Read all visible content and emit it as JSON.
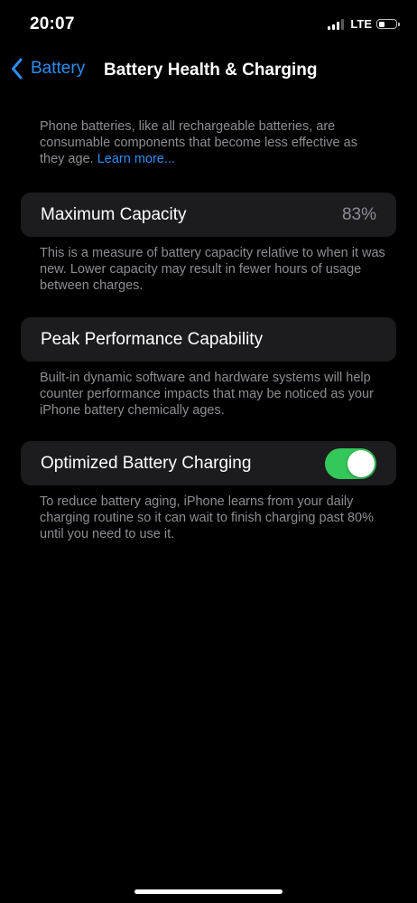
{
  "status_bar": {
    "time": "20:07",
    "network": "LTE",
    "signal_bars_active": 3,
    "signal_bars_total": 4,
    "battery_level": 0.4
  },
  "nav": {
    "back_label": "Battery",
    "title": "Battery Health & Charging"
  },
  "intro": {
    "text": "Phone batteries, like all rechargeable batteries, are consumable components that become less effective as they age.",
    "link": "Learn more..."
  },
  "maximum_capacity": {
    "label": "Maximum Capacity",
    "value": "83%",
    "description": "This is a measure of battery capacity relative to when it was new. Lower capacity may result in fewer hours of usage between charges."
  },
  "peak_performance": {
    "label": "Peak Performance Capability",
    "description": "Built-in dynamic software and hardware systems will help counter performance impacts that may be noticed as your iPhone battery chemically ages."
  },
  "optimized_charging": {
    "label": "Optimized Battery Charging",
    "enabled": true,
    "description": "To reduce battery aging, iPhone learns from your daily charging routine so it can wait to finish charging past 80% until you need to use it."
  },
  "colors": {
    "background": "#000000",
    "group_background": "#1c1c1e",
    "accent_blue": "#2e8cf0",
    "toggle_on": "#34c759",
    "secondary_text": "#8d8d93"
  }
}
